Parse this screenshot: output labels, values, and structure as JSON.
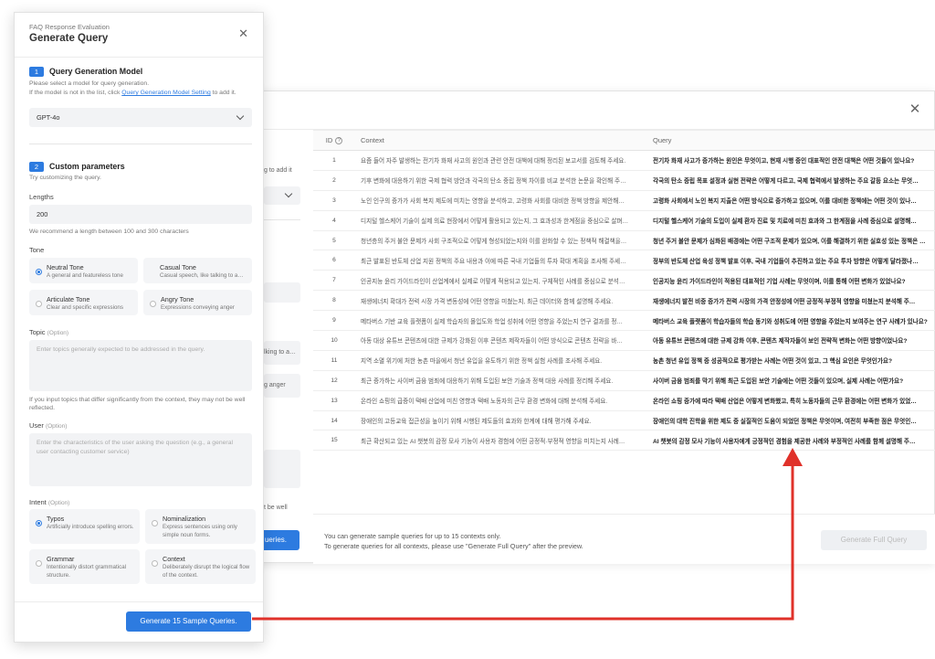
{
  "bg": {
    "table": {
      "headers": {
        "id": "ID",
        "context": "Context",
        "query": "Query"
      },
      "rows": [
        {
          "id": "1",
          "context": "요즘 들어 자주 발생하는 전기차 화재 사고의 원인과 관련 안전 대책에 대해 정리된 보고서를 검토해 주세요.",
          "query": "전기차 화재 사고가 증가하는 원인은 무엇이고, 현재 시행 중인 대표적인 안전 대책은 어떤 것들이 있나요?"
        },
        {
          "id": "2",
          "context": "기후 변화에 대응하기 위한 국제 협력 방안과 각국의 탄소 중립 정책 차이를 비교 분석한 논문을 확인해 주…",
          "query": "각국의 탄소 중립 목표 설정과 실현 전략은 어떻게 다르고, 국제 협력에서 발생하는 주요 갈등 요소는 무엇…"
        },
        {
          "id": "3",
          "context": "노인 인구의 증가가 사회 복지 제도에 미치는 영향을 분석하고, 고령화 사회를 대비한 정책 방향을 제안해…",
          "query": "고령화 사회에서 노인 복지 지출은 어떤 방식으로 증가하고 있으며, 이를 대비한 정책에는 어떤 것이 있나…"
        },
        {
          "id": "4",
          "context": "디지털 헬스케어 기술이 실제 의료 현장에서 어떻게 활용되고 있는지, 그 효과성과 한계점을 중심으로 살펴…",
          "query": "디지털 헬스케어 기술의 도입이 실제 환자 진료 및 치료에 미친 효과와 그 한계점을 사례 중심으로 설명해…"
        },
        {
          "id": "5",
          "context": "청년층의 주거 불안 문제가 사회 구조적으로 어떻게 형성되었는지와 이를 완화할 수 있는 정책적 해결책을…",
          "query": "청년 주거 불안 문제가 심화된 배경에는 어떤 구조적 문제가 있으며, 이를 해결하기 위한 실효성 있는 정책은 무…"
        },
        {
          "id": "6",
          "context": "최근 발표된 반도체 산업 지원 정책의 주요 내용과 이에 따른 국내 기업들의 투자 확대 계획을 조사해 주세…",
          "query": "정부의 반도체 산업 육성 정책 발표 이후, 국내 기업들이 추진하고 있는 주요 투자 방향은 어떻게 달라졌나…"
        },
        {
          "id": "7",
          "context": "인공지능 윤리 가이드라인이 산업계에서 실제로 어떻게 적용되고 있는지, 구체적인 사례를 중심으로 분석…",
          "query": "인공지능 윤리 가이드라인이 적용된 대표적인 기업 사례는 무엇이며, 이를 통해 어떤 변화가 있었나요?"
        },
        {
          "id": "8",
          "context": "재생에너지 확대가 전력 시장 가격 변동성에 어떤 영향을 미쳤는지, 최근 데이터와 함께 설명해 주세요.",
          "query": "재생에너지 발전 비중 증가가 전력 시장의 가격 안정성에 어떤 긍정적·부정적 영향을 미쳤는지 분석해 주…"
        },
        {
          "id": "9",
          "context": "메타버스 기반 교육 플랫폼이 실제 학습자의 몰입도와 학업 성취에 어떤 영향을 주었는지 연구 결과를 정…",
          "query": "메타버스 교육 플랫폼이 학습자들의 학습 동기와 성취도에 어떤 영향을 주었는지 보여주는 연구 사례가 있나요?"
        },
        {
          "id": "10",
          "context": "아동 대상 유튜브 콘텐츠에 대한 규제가 강화된 이후 콘텐츠 제작자들이 어떤 방식으로 콘텐츠 전략을 바…",
          "query": "아동 유튜브 콘텐츠에 대한 규제 강화 이후, 콘텐츠 제작자들이 보인 전략적 변화는 어떤 방향이었나요?"
        },
        {
          "id": "11",
          "context": "지역 소멸 위기에 처한 농촌 마을에서 청년 유입을 유도하기 위한 정책 실험 사례를 조사해 주세요.",
          "query": "농촌 청년 유입 정책 중 성공적으로 평가받는 사례는 어떤 것이 있고, 그 핵심 요인은 무엇인가요?"
        },
        {
          "id": "12",
          "context": "최근 증가하는 사이버 금융 범죄에 대응하기 위해 도입된 보안 기술과 정책 대응 사례를 정리해 주세요.",
          "query": "사이버 금융 범죄를 막기 위해 최근 도입된 보안 기술에는 어떤 것들이 있으며, 실제 사례는 어떤가요?"
        },
        {
          "id": "13",
          "context": "온라인 쇼핑의 급증이 택배 산업에 미친 영향과 택배 노동자의 근무 환경 변화에 대해 분석해 주세요.",
          "query": "온라인 쇼핑 증가에 따라 택배 산업은 어떻게 변화했고, 특히 노동자들의 근무 환경에는 어떤 변화가 있었…"
        },
        {
          "id": "14",
          "context": "장애인의 고등교육 접근성을 높이기 위해 시행된 제도들의 효과와 한계에 대해 평가해 주세요.",
          "query": "장애인의 대학 진학을 위한 제도 중 실질적인 도움이 되었던 정책은 무엇이며, 여전히 부족한 점은 무엇인…"
        },
        {
          "id": "15",
          "context": "최근 확산되고 있는 AI 챗봇의 감정 모사 기능이 사용자 경험에 어떤 긍정적·부정적 영향을 미치는지 사례…",
          "query": "AI 챗봇의 감정 모사 기능이 사용자에게 긍정적인 경험을 제공한 사례와 부정적인 사례를 함께 설명해 주…"
        }
      ]
    },
    "footer": {
      "note_line1": "You can generate sample queries for up to 15 contexts only.",
      "note_line2": "To generate queries for all contexts, please use \"Generate Full Query\" after the preview.",
      "full_button": "Generate Full Query"
    },
    "peek": {
      "add": "g to add it",
      "tone1": "lking to a…",
      "tone2": "g anger",
      "note": "t be well",
      "button": "ueries."
    }
  },
  "panel": {
    "subtitle": "FAQ Response Evaluation",
    "title": "Generate Query",
    "section1": {
      "num": "1",
      "title": "Query Generation Model",
      "desc1": "Please select a model for query generation.",
      "desc2_prefix": "If the model is not in the list, click ",
      "desc2_link": "Query Generation Model Setting",
      "desc2_suffix": " to add it.",
      "model": "GPT-4o"
    },
    "section2": {
      "num": "2",
      "title": "Custom parameters",
      "desc": "Try customizing the query.",
      "lengths_label": "Lengths",
      "lengths_value": "200",
      "lengths_hint": "We recommend a length between 100 and 300 characters",
      "tone_label": "Tone",
      "tones": [
        {
          "title": "Neutral Tone",
          "desc": "A general and featureless tone"
        },
        {
          "title": "Casual Tone",
          "desc": "Casual speech, like talking to a…"
        },
        {
          "title": "Articulate Tone",
          "desc": "Clear and specific expressions"
        },
        {
          "title": "Angry Tone",
          "desc": "Expressions conveying anger"
        }
      ],
      "topic_label": "Topic",
      "topic_optional": "(Option)",
      "topic_placeholder": "Enter topics generally expected to be addressed in the query.",
      "topic_hint": "If you input topics that differ significantly from the context, they may not be well reflected.",
      "user_label": "User",
      "user_optional": "(Option)",
      "user_placeholder": "Enter the characteristics of the user asking the question (e.g., a general user contacting customer service)",
      "intent_label": "Intent",
      "intent_optional": "(Option)",
      "intents": [
        {
          "title": "Typos",
          "desc": "Artificially introduce spelling errors."
        },
        {
          "title": "Nominalization",
          "desc": "Express sentences using only simple noun forms."
        },
        {
          "title": "Grammar",
          "desc": "Intentionally distort grammatical structure."
        },
        {
          "title": "Context",
          "desc": "Deliberately disrupt the logical flow of the context."
        }
      ]
    },
    "generate_button": "Generate 15 Sample Queries."
  },
  "colors": {
    "accent": "#2d7be0",
    "arrow": "#e0312a"
  }
}
